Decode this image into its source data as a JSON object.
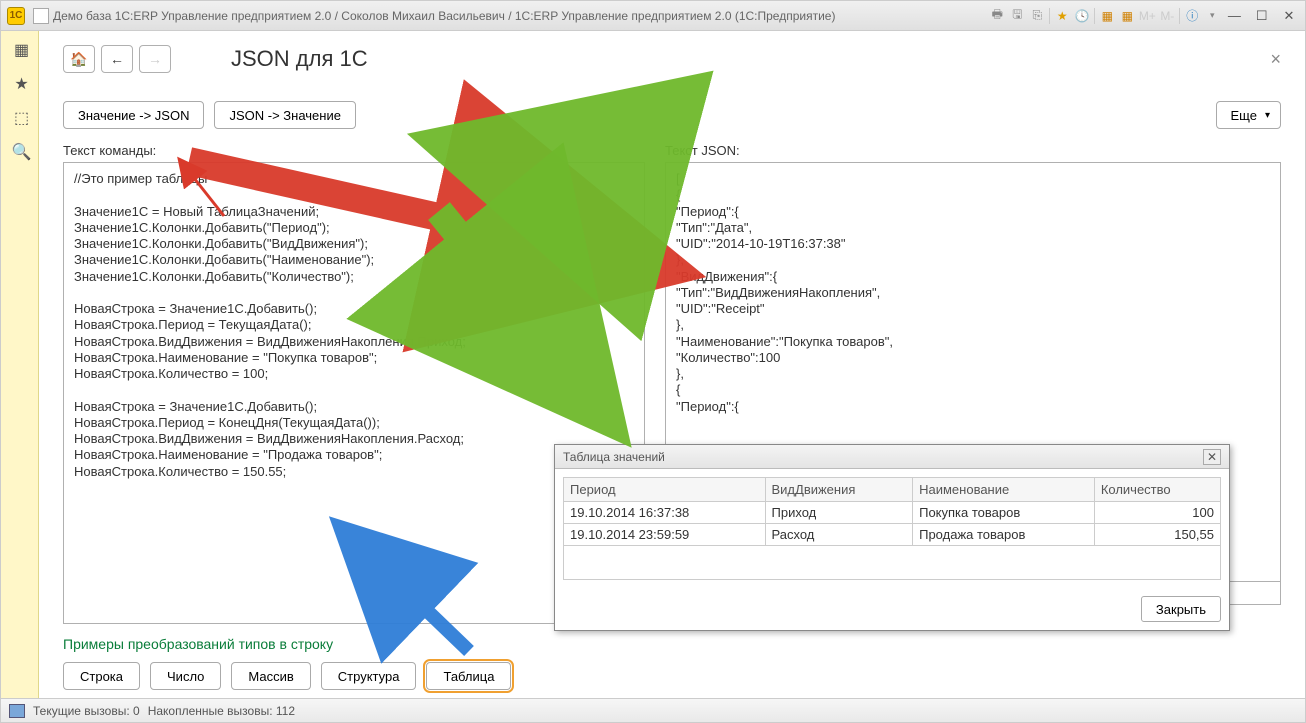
{
  "titlebar": {
    "text": "Демо база 1С:ERP Управление предприятием 2.0 / Соколов Михаил Васильевич / 1С:ERP Управление предприятием 2.0  (1С:Предприятие)"
  },
  "page_title": "JSON для 1С",
  "actions": {
    "to_json": "Значение -> JSON",
    "to_value": "JSON -> Значение",
    "more": "Еще"
  },
  "labels": {
    "command_text": "Текст команды:",
    "json_text": "Текст JSON:"
  },
  "command_code": "//Это пример таблицы\n\nЗначение1С = Новый ТаблицаЗначений;\nЗначение1С.Колонки.Добавить(\"Период\");\nЗначение1С.Колонки.Добавить(\"ВидДвижения\");\nЗначение1С.Колонки.Добавить(\"Наименование\");\nЗначение1С.Колонки.Добавить(\"Количество\");\n\nНоваяСтрока = Значение1С.Добавить();\nНоваяСтрока.Период = ТекущаяДата();\nНоваяСтрока.ВидДвижения = ВидДвиженияНакопления.Приход;\nНоваяСтрока.Наименование = \"Покупка товаров\";\nНоваяСтрока.Количество = 100;\n\nНоваяСтрока = Значение1С.Добавить();\nНоваяСтрока.Период = КонецДня(ТекущаяДата());\nНоваяСтрока.ВидДвижения = ВидДвиженияНакопления.Расход;\nНоваяСтрока.Наименование = \"Продажа товаров\";\nНоваяСтрока.Количество = 150.55;",
  "json_code": "[\n{\n\"Период\":{\n\"Тип\":\"Дата\",\n\"UID\":\"2014-10-19T16:37:38\"\n},\n\"ВидДвижения\":{\n\"Тип\":\"ВидДвиженияНакопления\",\n\"UID\":\"Receipt\"\n},\n\"Наименование\":\"Покупка товаров\",\n\"Количество\":100\n},\n{\n\"Период\":{",
  "json_tail": "]",
  "examples_title": "Примеры преобразований типов в строку",
  "examples": {
    "string": "Строка",
    "number": "Число",
    "array": "Массив",
    "struct": "Структура",
    "table": "Таблица"
  },
  "popup": {
    "title": "Таблица значений",
    "headers": [
      "Период",
      "ВидДвижения",
      "Наименование",
      "Количество"
    ],
    "rows": [
      {
        "period": "19.10.2014 16:37:38",
        "kind": "Приход",
        "name": "Покупка товаров",
        "qty": "100"
      },
      {
        "period": "19.10.2014 23:59:59",
        "kind": "Расход",
        "name": "Продажа товаров",
        "qty": "150,55"
      }
    ],
    "close_btn": "Закрыть"
  },
  "statusbar": {
    "current_calls": "Текущие вызовы: 0",
    "accumulated_calls": "Накопленные вызовы: 112"
  }
}
